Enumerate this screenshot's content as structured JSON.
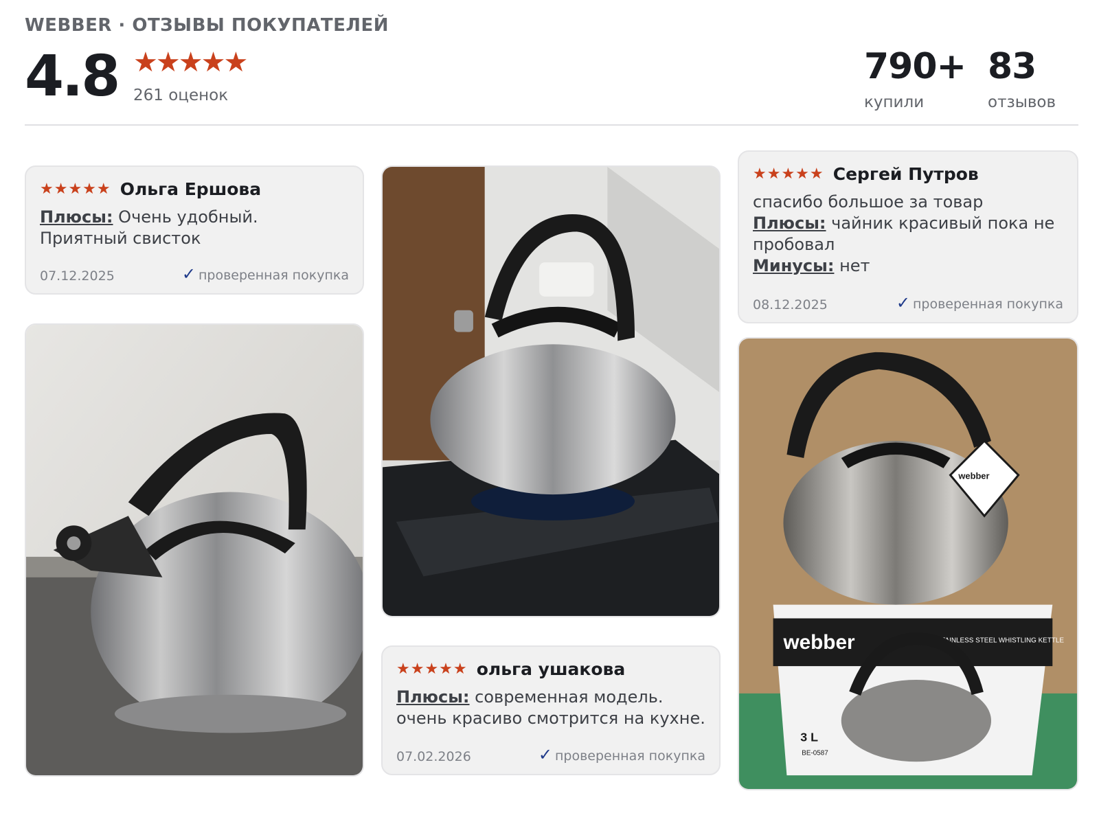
{
  "header": {
    "kicker": "WEBBER · ОТЗЫВЫ ПОКУПАТЕЛЕЙ",
    "rating": "4.8",
    "stars": "★★★★★",
    "ratings_count": "261 оценок",
    "stats": [
      {
        "value": "790+",
        "label": "купили"
      },
      {
        "value": "83",
        "label": "отзывов"
      }
    ]
  },
  "reviews": [
    {
      "stars": "★★★★★",
      "author": "Ольга Ершова",
      "plus_label": "Плюсы:",
      "plus_text": "Очень удобный. Приятный свисток",
      "date": "07.12.2025",
      "verified": "проверенная покупка"
    },
    {
      "stars": "★★★★★",
      "author": "Сергей Путров",
      "comment": "спасибо большое за товар",
      "plus_label": "Плюсы:",
      "plus_text": "чайник красивый пока не пробовал",
      "minus_label": "Минусы:",
      "minus_text": "нет",
      "date": "08.12.2025",
      "verified": "проверенная покупка"
    },
    {
      "stars": "★★★★★",
      "author": "ольга ушакова",
      "plus_label": "Плюсы:",
      "plus_text": "современная модель. очень красиво смотрится на кухне.",
      "date": "07.02.2026",
      "verified": "проверенная покупка"
    }
  ],
  "photos": {
    "box_brand": "webber",
    "box_caption": "STAINLESS STEEL WHISTLING KETTLE",
    "box_volume": "3 L",
    "box_model": "BE-0587",
    "tag_brand": "webber"
  },
  "colors": {
    "star": "#c9411c",
    "check": "#1f3a8a",
    "card_bg": "#f1f1f1"
  }
}
